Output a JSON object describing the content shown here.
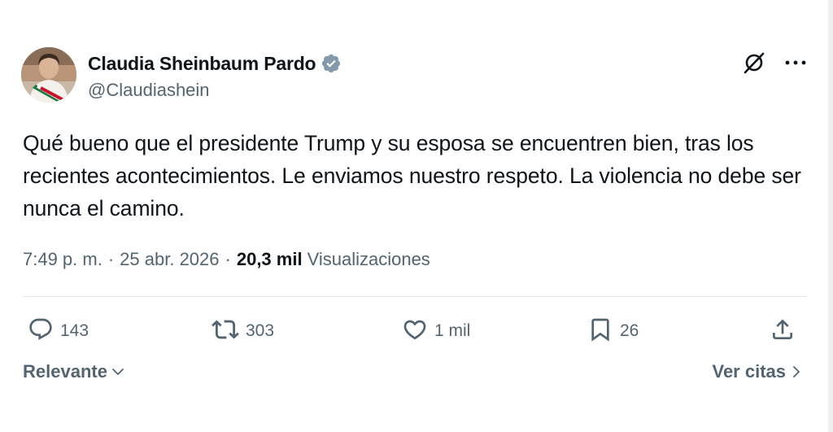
{
  "author": {
    "display_name": "Claudia Sheinbaum Pardo",
    "handle": "@Claudiashein",
    "verified_icon": "verified-badge-icon",
    "verified_color": "#829aab"
  },
  "tweet": {
    "text": "Qué bueno que el presidente Trump y su esposa se encuentren bien, tras los recientes acontecimientos. Le enviamos nuestro respeto. La violencia no debe ser nunca el camino.",
    "time": "7:49 p. m.",
    "separator": "·",
    "date": "25 abr. 2026",
    "views_count": "20,3 mil",
    "views_label": "Visualizaciones"
  },
  "header_icons": [
    "grok-icon",
    "more-icon"
  ],
  "actions": {
    "replies": "143",
    "reposts": "303",
    "likes": "1 mil",
    "bookmarks": "26"
  },
  "footer": {
    "sort_label": "Relevante",
    "quotes_label": "Ver citas"
  },
  "colors": {
    "text_primary": "#0f1419",
    "text_secondary": "#536471",
    "divider": "#e6e9ec"
  }
}
